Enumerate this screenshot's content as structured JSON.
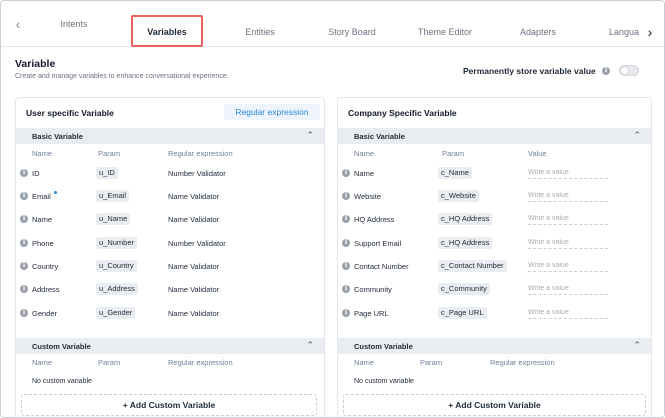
{
  "tabs": [
    {
      "label": "Intents"
    },
    {
      "label": "Variables"
    },
    {
      "label": "Entities"
    },
    {
      "label": "Story Board"
    },
    {
      "label": "Theme Editor"
    },
    {
      "label": "Adapters"
    },
    {
      "label": "Langua"
    }
  ],
  "header": {
    "title": "Variable",
    "subtitle": "Create and manage variables to enhance conversational experience.",
    "permanent_label": "Permanently store variable value",
    "permanent_enabled": false
  },
  "left": {
    "title": "User specific Variable",
    "regex_button": "Regular expression",
    "basic": {
      "title": "Basic Variable",
      "columns": [
        "Name",
        "Param",
        "Regular expression"
      ],
      "rows": [
        {
          "name": "ID",
          "param": "u_ID",
          "regex": "Number Validator"
        },
        {
          "name": "Email",
          "param": "u_Email",
          "regex": "Name Validator"
        },
        {
          "name": "Name",
          "param": "u_Name",
          "regex": "Name Validator"
        },
        {
          "name": "Phone",
          "param": "u_Number",
          "regex": "Number Validator"
        },
        {
          "name": "Country",
          "param": "u_Country",
          "regex": "Name Validator"
        },
        {
          "name": "Address",
          "param": "u_Address",
          "regex": "Name Validator"
        },
        {
          "name": "Gender",
          "param": "u_Gender",
          "regex": "Name Validator"
        }
      ]
    },
    "custom": {
      "title": "Custom Variable",
      "columns": [
        "Name",
        "Param",
        "Regular expression"
      ],
      "empty_text": "No custom variable",
      "add_button": "+ Add Custom Variable"
    }
  },
  "right": {
    "title": "Company Specific Variable",
    "basic": {
      "title": "Basic Variable",
      "columns": [
        "Name",
        "Param",
        "Value"
      ],
      "value_placeholder": "Write a value",
      "rows": [
        {
          "name": "Name",
          "param": "c_Name"
        },
        {
          "name": "Website",
          "param": "c_Website"
        },
        {
          "name": "HQ Address",
          "param": "c_HQ Address"
        },
        {
          "name": "Support Email",
          "param": "c_HQ Address"
        },
        {
          "name": "Contact Number",
          "param": "c_Contact Number"
        },
        {
          "name": "Community",
          "param": "c_Community"
        },
        {
          "name": "Page URL",
          "param": "c_Page URL"
        }
      ]
    },
    "custom": {
      "title": "Custom Variable",
      "columns": [
        "Name",
        "Param",
        "Regular expression"
      ],
      "empty_text": "No custom variable",
      "add_button": "+ Add Custom Variable"
    }
  },
  "colors": {
    "accent": "#2b8ad8",
    "active_tab_border": "#e9635a",
    "section_bg": "#e9ecf0"
  },
  "icons": {
    "tab_prev": "chevron-left-icon",
    "tab_next": "chevron-right-icon",
    "info": "info-icon",
    "collapse": "chevron-up-icon"
  }
}
